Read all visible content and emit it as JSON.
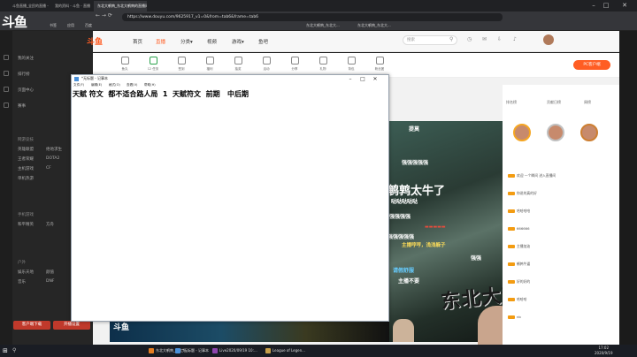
{
  "browser": {
    "tabs": [
      "斗鱼直播_全民的直播 - 斗鱼直播",
      "我的资料 - 斗鱼 - 直播",
      "东北大鹌鹑_东北大鹌鹑的直播间"
    ],
    "url": "https://www.douyu.com/9625917_v1=0&from=tab6&frame=tab6"
  },
  "bookmarks": [
    "书签",
    "应用",
    "百度",
    "东北大鹌鹑_东北大...",
    "东北大鹌鹑_东北大..."
  ],
  "sidebar": {
    "logo": "斗鱼",
    "items": [
      "我的关注",
      "排行榜",
      "页面中心",
      "赛事",
      "网游竞技",
      "英雄联盟",
      "绝地求生",
      "王者荣耀",
      "DOTA2",
      "主机游戏",
      "CF",
      "单机热游",
      "手机游戏",
      "和平精英",
      "方舟",
      "户外",
      "娱乐天地",
      "颜值",
      "音乐",
      "DNF"
    ],
    "buttons": [
      "客户端下载",
      "开播设置"
    ]
  },
  "header": {
    "nav": [
      "首页",
      "直播",
      "分类▾",
      "视频",
      "游戏▾",
      "鱼吧"
    ],
    "search_placeholder": "搜索"
  },
  "toolbar": {
    "items": [
      "鱼丸",
      "12 任务",
      "签到",
      "福利",
      "抽奖",
      "活动",
      "分享",
      "礼物",
      "背包",
      "粉丝团"
    ],
    "pc_button": "PC客户端"
  },
  "notepad": {
    "title": "*无标题 - 记事本",
    "menu": [
      "文件(F)",
      "编辑(E)",
      "格式(O)",
      "查看(V)",
      "帮助(H)"
    ],
    "content": "天赋 符文  都不适合路人局  1  天赋符文  前期   中后期"
  },
  "danmaku": [
    {
      "text": "提莫",
      "color": "#ffffff"
    },
    {
      "text": "强强强强强",
      "color": "#ffffff"
    },
    {
      "text": "鹌鹑太牛了",
      "color": "#ffffff"
    },
    {
      "text": "哒哒哒哒哒",
      "color": "#ffffff"
    },
    {
      "text": "强强强强",
      "color": "#ffffff"
    },
    {
      "text": "强强强强强",
      "color": "#ffffff"
    },
    {
      "text": "主播哼哼，浅浅躲子",
      "color": "#ffde59"
    },
    {
      "text": "强强",
      "color": "#ffffff"
    },
    {
      "text": "请假舒服",
      "color": "#66ccff"
    },
    {
      "text": "主播不要",
      "color": "#ffffff"
    }
  ],
  "overlay_brand": "东北大鹌鹑",
  "chat": {
    "tabs": [
      "排名榜",
      "贡献日榜",
      "周榜"
    ],
    "lines": [
      "欢迎 一个瞬间 进入直播间",
      "你说的真的好",
      "哈哈哈哈",
      "666666",
      "主播加油",
      "鹌鹑牛逼",
      "好的好的",
      "哈哈哈",
      "nb",
      "主播好帅"
    ]
  },
  "taskbar": {
    "items": [
      "东北大鹌鹑_东北大...",
      "*无标题 - 记事本",
      "Live2020/09/19 10:...",
      "League of Legen..."
    ],
    "time": "17:02",
    "date": "2020/9/19"
  },
  "colors": {
    "accent": "#ff5d23",
    "sidebar": "#262626"
  }
}
